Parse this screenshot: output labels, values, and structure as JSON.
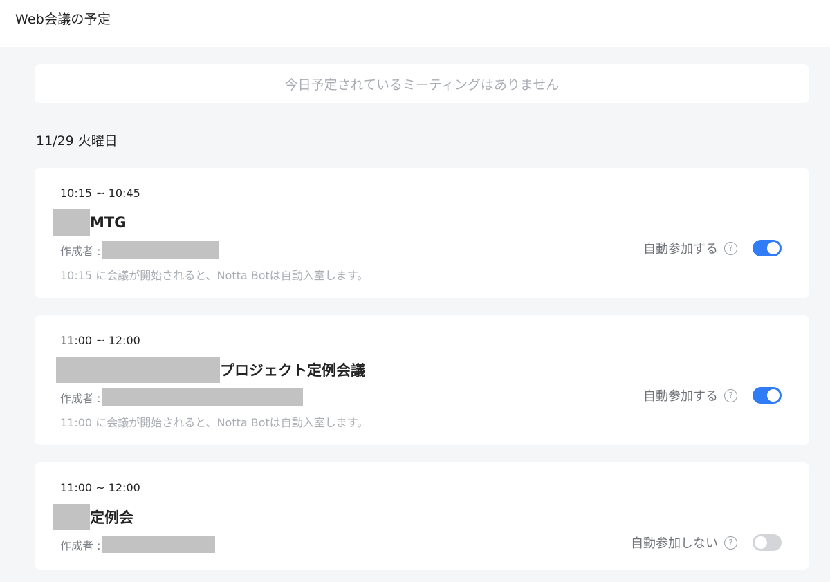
{
  "page": {
    "title": "Web会議の予定"
  },
  "today_banner": {
    "text": "今日予定されているミーティングはありません"
  },
  "date_header": "11/29 火曜日",
  "common": {
    "creator_label": "作成者 :",
    "accent_color": "#2f7cf6",
    "toggle_off_color": "#d3d5d9"
  },
  "meetings": [
    {
      "time": "10:15 ~ 10:45",
      "title_suffix": "MTG",
      "notice": "10:15 に会議が開始されると、Notta Botは自動入室します。",
      "auto_join_label": "自動参加する",
      "auto_join": true
    },
    {
      "time": "11:00 ~ 12:00",
      "title_suffix": "プロジェクト定例会議",
      "notice": "11:00 に会議が開始されると、Notta Botは自動入室します。",
      "auto_join_label": "自動参加する",
      "auto_join": true
    },
    {
      "time": "11:00 ~ 12:00",
      "title_suffix": "定例会",
      "notice": "",
      "auto_join_label": "自動参加しない",
      "auto_join": false
    }
  ]
}
